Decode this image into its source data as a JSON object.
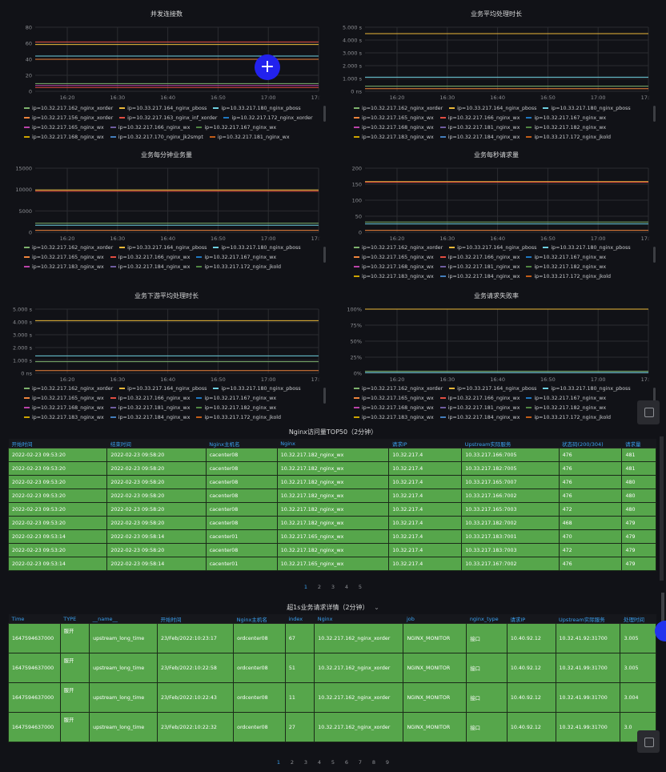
{
  "colors": {
    "grid": "#2b2c31",
    "axis": "#8e9095",
    "accent": "#3aa0f0",
    "cell": "#56a64b",
    "cursor": "#2222ee"
  },
  "panels": [
    {
      "title": "并发连接数",
      "yticks": [
        "80",
        "60",
        "40",
        "20",
        "0"
      ],
      "xticks": [
        "16:20",
        "16:30",
        "16:40",
        "16:50",
        "17:00",
        "17:10"
      ],
      "lines": [
        {
          "v": 0.77,
          "c": "#e24d42"
        },
        {
          "v": 0.73,
          "c": "#eab839"
        },
        {
          "v": 0.55,
          "c": "#6ed0e0"
        },
        {
          "v": 0.5,
          "c": "#ef843c"
        },
        {
          "v": 0.06,
          "c": "#e24d42"
        },
        {
          "v": 0.12,
          "c": "#7eb26d"
        },
        {
          "v": 0.09,
          "c": "#ba43a9"
        }
      ],
      "legend": [
        [
          "ip=10.32.217.162_nginx_xorder",
          "ip=10.33.217.164_nginx_pboss",
          "ip=10.33.217.180_nginx_pboss"
        ],
        [
          "ip=10.32.217.156_nginx_xorder",
          "ip=10.32.217.163_nginx_inf_xorder",
          "ip=10.32.217.172_nginx_xorder"
        ],
        [
          "ip=10.32.217.165_nginx_wx",
          "ip=10.32.217.166_nginx_wx",
          "ip=10.32.217.167_nginx_wx"
        ],
        [
          "ip=10.32.217.168_nginx_wx",
          "ip=10.32.217.170_nginx_jk2smpt",
          "ip=10.32.217.181_nginx_wx"
        ]
      ]
    },
    {
      "title": "业务平均处理时长",
      "yticks": [
        "5.000 s",
        "4.000 s",
        "3.000 s",
        "2.000 s",
        "1.000 s",
        "0 ns"
      ],
      "xticks": [
        "16:20",
        "16:30",
        "16:40",
        "16:50",
        "17:00",
        "17:10"
      ],
      "lines": [
        {
          "v": 0.9,
          "c": "#eab839"
        },
        {
          "v": 0.22,
          "c": "#6ed0e0"
        },
        {
          "v": 0.08,
          "c": "#7eb26d"
        },
        {
          "v": 0.04,
          "c": "#ef843c"
        }
      ],
      "legend": [
        [
          "ip=10.32.217.162_nginx_xorder",
          "ip=10.33.217.164_nginx_pboss",
          "ip=10.33.217.180_nginx_pboss"
        ],
        [
          "ip=10.32.217.165_nginx_wx",
          "ip=10.32.217.166_nginx_wx",
          "ip=10.32.217.167_nginx_wx"
        ],
        [
          "ip=10.32.217.168_nginx_wx",
          "ip=10.32.217.181_nginx_wx",
          "ip=10.32.217.182_nginx_wx"
        ],
        [
          "ip=10.32.217.183_nginx_wx",
          "ip=10.32.217.184_nginx_wx",
          "ip=10.33.217.172_nginx_jkold"
        ]
      ]
    },
    {
      "title": "业务每分钟业务量",
      "yticks": [
        "15000",
        "10000",
        "5000",
        "0"
      ],
      "xticks": [
        "16:20",
        "16:30",
        "16:40",
        "16:50",
        "17:00",
        "17:10"
      ],
      "lines": [
        {
          "v": 0.66,
          "c": "#eab839"
        },
        {
          "v": 0.64,
          "c": "#e24d42"
        },
        {
          "v": 0.14,
          "c": "#7eb26d"
        },
        {
          "v": 0.11,
          "c": "#6ed0e0"
        },
        {
          "v": 0.03,
          "c": "#ef843c"
        }
      ],
      "legend": [
        [
          "ip=10.32.217.162_nginx_xorder",
          "ip=10.33.217.164_nginx_pboss",
          "ip=10.33.217.180_nginx_pboss"
        ],
        [
          "ip=10.32.217.165_nginx_wx",
          "ip=10.32.217.166_nginx_wx",
          "ip=10.32.217.167_nginx_wx"
        ],
        [
          "ip=10.32.217.183_nginx_wx",
          "ip=10.32.217.184_nginx_wx",
          "ip=10.33.217.172_nginx_jkold"
        ]
      ]
    },
    {
      "title": "业务每秒请求量",
      "yticks": [
        "200",
        "150",
        "100",
        "50",
        "0"
      ],
      "xticks": [
        "16:20",
        "16:30",
        "16:40",
        "16:50",
        "17:00",
        "17:10"
      ],
      "lines": [
        {
          "v": 0.79,
          "c": "#eab839"
        },
        {
          "v": 0.78,
          "c": "#e24d42"
        },
        {
          "v": 0.16,
          "c": "#7eb26d"
        },
        {
          "v": 0.13,
          "c": "#6ed0e0"
        },
        {
          "v": 0.03,
          "c": "#ef843c"
        }
      ],
      "legend": [
        [
          "ip=10.32.217.162_nginx_xorder",
          "ip=10.33.217.164_nginx_pboss",
          "ip=10.33.217.180_nginx_pboss"
        ],
        [
          "ip=10.32.217.165_nginx_wx",
          "ip=10.32.217.166_nginx_wx",
          "ip=10.32.217.167_nginx_wx"
        ],
        [
          "ip=10.32.217.168_nginx_wx",
          "ip=10.32.217.181_nginx_wx",
          "ip=10.32.217.182_nginx_wx"
        ],
        [
          "ip=10.32.217.183_nginx_wx",
          "ip=10.32.217.184_nginx_wx",
          "ip=10.33.217.172_nginx_jkold"
        ]
      ]
    },
    {
      "title": "业务下游平均处理时长",
      "yticks": [
        "5.000 s",
        "4.000 s",
        "3.000 s",
        "2.000 s",
        "1.000 s",
        "0 ns"
      ],
      "xticks": [
        "16:20",
        "16:30",
        "16:40",
        "16:50",
        "17:00",
        "17:10"
      ],
      "lines": [
        {
          "v": 0.82,
          "c": "#eab839"
        },
        {
          "v": 0.27,
          "c": "#6ed0e0"
        },
        {
          "v": 0.18,
          "c": "#7eb26d"
        },
        {
          "v": 0.04,
          "c": "#ef843c"
        }
      ],
      "legend": [
        [
          "ip=10.32.217.162_nginx_xorder",
          "ip=10.33.217.164_nginx_pboss",
          "ip=10.33.217.180_nginx_pboss"
        ],
        [
          "ip=10.32.217.165_nginx_wx",
          "ip=10.32.217.166_nginx_wx",
          "ip=10.32.217.167_nginx_wx"
        ],
        [
          "ip=10.32.217.168_nginx_wx",
          "ip=10.32.217.181_nginx_wx",
          "ip=10.32.217.182_nginx_wx"
        ],
        [
          "ip=10.32.217.183_nginx_wx",
          "ip=10.32.217.184_nginx_wx",
          "ip=10.33.217.172_nginx_jkold"
        ]
      ]
    },
    {
      "title": "业务请求失败率",
      "yticks": [
        "100%",
        "75%",
        "50%",
        "25%",
        "0%"
      ],
      "xticks": [
        "16:20",
        "16:30",
        "16:40",
        "16:50",
        "17:00",
        "17:10"
      ],
      "lines": [
        {
          "v": 1.0,
          "c": "#eab839"
        },
        {
          "v": 0.03,
          "c": "#7eb26d"
        },
        {
          "v": 0.01,
          "c": "#6ed0e0"
        }
      ],
      "legend": [
        [
          "ip=10.32.217.162_nginx_xorder",
          "ip=10.33.217.164_nginx_pboss",
          "ip=10.33.217.180_nginx_pboss"
        ],
        [
          "ip=10.32.217.165_nginx_wx",
          "ip=10.32.217.166_nginx_wx",
          "ip=10.32.217.167_nginx_wx"
        ],
        [
          "ip=10.32.217.168_nginx_wx",
          "ip=10.32.217.181_nginx_wx",
          "ip=10.32.217.182_nginx_wx"
        ],
        [
          "ip=10.32.217.183_nginx_wx",
          "ip=10.32.217.184_nginx_wx",
          "ip=10.33.217.172_nginx_jkold"
        ]
      ]
    }
  ],
  "table1": {
    "title": "Nginx访问量TOP50（2分钟）",
    "headers": [
      "开始时间",
      "结束时间",
      "Nginx主机名",
      "Nginx",
      "请求IP",
      "Upstream实际服务",
      "状态码(200/304)",
      "请求量"
    ],
    "rows": [
      [
        "2022-02-23 09:53:20",
        "2022-02-23 09:58:20",
        "cacenter08",
        "10.32.217.182_nginx_wx",
        "10.32.217.4",
        "10.33.217.166:7005",
        "476",
        "481"
      ],
      [
        "2022-02-23 09:53:20",
        "2022-02-23 09:58:20",
        "cacenter08",
        "10.32.217.182_nginx_wx",
        "10.32.217.4",
        "10.33.217.182:7005",
        "476",
        "481"
      ],
      [
        "2022-02-23 09:53:20",
        "2022-02-23 09:58:20",
        "cacenter08",
        "10.32.217.182_nginx_wx",
        "10.32.217.4",
        "10.33.217.165:7007",
        "476",
        "480"
      ],
      [
        "2022-02-23 09:53:20",
        "2022-02-23 09:58:20",
        "cacenter08",
        "10.32.217.182_nginx_wx",
        "10.32.217.4",
        "10.33.217.166:7002",
        "476",
        "480"
      ],
      [
        "2022-02-23 09:53:20",
        "2022-02-23 09:58:20",
        "cacenter08",
        "10.32.217.182_nginx_wx",
        "10.32.217.4",
        "10.33.217.165:7003",
        "472",
        "480"
      ],
      [
        "2022-02-23 09:53:20",
        "2022-02-23 09:58:20",
        "cacenter08",
        "10.32.217.182_nginx_wx",
        "10.32.217.4",
        "10.33.217.182:7002",
        "468",
        "479"
      ],
      [
        "2022-02-23 09:53:14",
        "2022-02-23 09:58:14",
        "cacenter01",
        "10.32.217.165_nginx_wx",
        "10.32.217.4",
        "10.33.217.183:7001",
        "470",
        "479"
      ],
      [
        "2022-02-23 09:53:20",
        "2022-02-23 09:58:20",
        "cacenter08",
        "10.32.217.182_nginx_wx",
        "10.32.217.4",
        "10.33.217.183:7003",
        "472",
        "479"
      ],
      [
        "2022-02-23 09:53:14",
        "2022-02-23 09:58:14",
        "cacenter01",
        "10.32.217.165_nginx_wx",
        "10.32.217.4",
        "10.33.217.167:7002",
        "476",
        "479"
      ]
    ],
    "pages": [
      "1",
      "2",
      "3",
      "4",
      "5"
    ]
  },
  "table2": {
    "title": "超1s业务请求详情（2分钟）",
    "headers": [
      "Time",
      "TYPE",
      "__name__",
      "开始时间",
      "Nginx主机名",
      "index",
      "Nginx",
      "job",
      "nginx_type",
      "请求IP",
      "Upstream实际服务",
      "处理时间"
    ],
    "rows": [
      [
        "1647594637000",
        "服开",
        "upstream_long_time",
        "23/Feb/2022:10:23:17",
        "ordcenter08",
        "67",
        "10.32.217.162_nginx_xorder",
        "NGINX_MONITOR",
        "接口",
        "10.40.92.12",
        "10.32.41.92:31700",
        "3.005"
      ],
      [
        "1647594637000",
        "服开",
        "upstream_long_time",
        "23/Feb/2022:10:22:58",
        "ordcenter08",
        "51",
        "10.32.217.162_nginx_xorder",
        "NGINX_MONITOR",
        "接口",
        "10.40.92.12",
        "10.32.41.99:31700",
        "3.005"
      ],
      [
        "1647594637000",
        "服开",
        "upstream_long_time",
        "23/Feb/2022:10:22:43",
        "ordcenter08",
        "11",
        "10.32.217.162_nginx_xorder",
        "NGINX_MONITOR",
        "接口",
        "10.40.92.12",
        "10.32.41.99:31700",
        "3.004"
      ],
      [
        "1647594637000",
        "服开",
        "upstream_long_time",
        "23/Feb/2022:10:22:32",
        "ordcenter08",
        "27",
        "10.32.217.162_nginx_xorder",
        "NGINX_MONITOR",
        "接口",
        "10.40.92.12",
        "10.32.41.99:31700",
        "3.0"
      ]
    ],
    "pages": [
      "1",
      "2",
      "3",
      "4",
      "5",
      "6",
      "7",
      "8",
      "9"
    ]
  }
}
